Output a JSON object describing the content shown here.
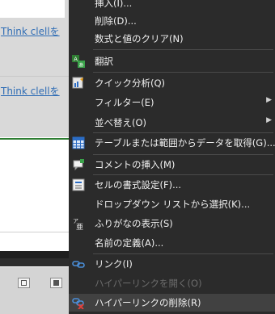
{
  "sheet": {
    "links": [
      "Think clellを",
      "Think clellを"
    ]
  },
  "menu": {
    "items": [
      {
        "label": "挿入(I)...",
        "icon": "none"
      },
      {
        "label": "削除(D)...",
        "icon": "none"
      },
      {
        "label": "数式と値のクリア(N)",
        "icon": "none"
      },
      {
        "label": "翻訳",
        "icon": "translate-icon"
      },
      {
        "label": "クイック分析(Q)",
        "icon": "quick-analysis-icon"
      },
      {
        "label": "フィルター(E)",
        "icon": "none",
        "submenu": true
      },
      {
        "label": "並べ替え(O)",
        "icon": "none",
        "submenu": true
      },
      {
        "label": "テーブルまたは範囲からデータを取得(G)...",
        "icon": "table-icon"
      },
      {
        "label": "コメントの挿入(M)",
        "icon": "comment-icon"
      },
      {
        "label": "セルの書式設定(F)...",
        "icon": "format-cells-icon"
      },
      {
        "label": "ドロップダウン リストから選択(K)...",
        "icon": "none"
      },
      {
        "label": "ふりがなの表示(S)",
        "icon": "phonetic-icon"
      },
      {
        "label": "名前の定義(A)...",
        "icon": "none"
      },
      {
        "label": "リンク(I)",
        "icon": "link-icon"
      },
      {
        "label": "ハイパーリンクを開く(O)",
        "icon": "none",
        "disabled": true
      },
      {
        "label": "ハイパーリンクの削除(R)",
        "icon": "remove-hyperlink-icon",
        "highlighted": true
      }
    ],
    "submenu_arrow": "▶",
    "colors": {
      "background": "#2b2b2b",
      "text": "#f0f0f0",
      "disabled": "#6c6c6c",
      "highlight": "#414141",
      "link": "#2f6db5"
    }
  }
}
